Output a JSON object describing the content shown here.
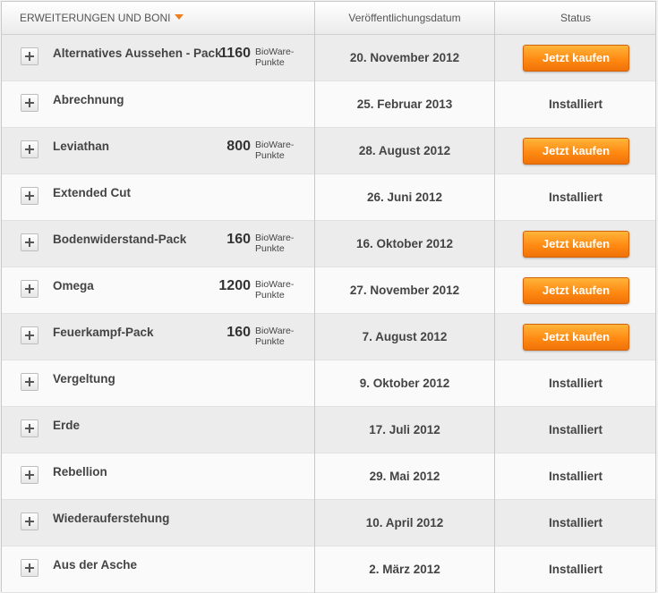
{
  "header": {
    "col_name": "ERWEITERUNGEN UND BONI",
    "col_date": "Veröffentlichungsdatum",
    "col_status": "Status"
  },
  "price_unit_line1": "BioWare-",
  "price_unit_line2": "Punkte",
  "buy_label": "Jetzt kaufen",
  "installed_label": "Installiert",
  "rows": [
    {
      "name": "Alternatives Aussehen - Pack",
      "price": "1160",
      "date": "20. November 2012",
      "status": "buy"
    },
    {
      "name": "Abrechnung",
      "price": "",
      "date": "25. Februar 2013",
      "status": "installed"
    },
    {
      "name": "Leviathan",
      "price": "800",
      "date": "28. August 2012",
      "status": "buy"
    },
    {
      "name": "Extended Cut",
      "price": "",
      "date": "26. Juni 2012",
      "status": "installed"
    },
    {
      "name": "Bodenwiderstand-Pack",
      "price": "160",
      "date": "16. Oktober 2012",
      "status": "buy"
    },
    {
      "name": "Omega",
      "price": "1200",
      "date": "27. November 2012",
      "status": "buy"
    },
    {
      "name": "Feuerkampf-Pack",
      "price": "160",
      "date": "7. August 2012",
      "status": "buy"
    },
    {
      "name": "Vergeltung",
      "price": "",
      "date": "9. Oktober 2012",
      "status": "installed"
    },
    {
      "name": "Erde",
      "price": "",
      "date": "17. Juli 2012",
      "status": "installed"
    },
    {
      "name": "Rebellion",
      "price": "",
      "date": "29. Mai 2012",
      "status": "installed"
    },
    {
      "name": "Wiederauferstehung",
      "price": "",
      "date": "10. April 2012",
      "status": "installed"
    },
    {
      "name": "Aus der Asche",
      "price": "",
      "date": "2. März 2012",
      "status": "installed"
    }
  ],
  "colors": {
    "accent": "#ff8a12",
    "row_alt": "#ececec"
  }
}
